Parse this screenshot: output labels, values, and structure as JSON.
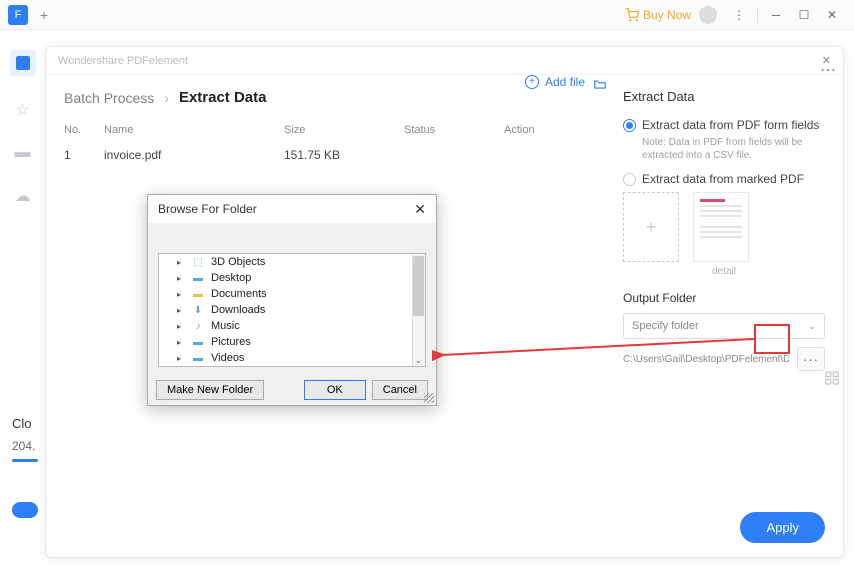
{
  "titlebar": {
    "buy_now": "Buy Now"
  },
  "modal": {
    "app_name": "Wondershare PDFelement",
    "breadcrumb_prev": "Batch Process",
    "breadcrumb_cur": "Extract Data",
    "add_file": "Add file",
    "headers": {
      "no": "No.",
      "name": "Name",
      "size": "Size",
      "status": "Status",
      "action": "Action"
    },
    "rows": [
      {
        "no": "1",
        "name": "invoice.pdf",
        "size": "151.75 KB",
        "status": "",
        "action": ""
      }
    ]
  },
  "right": {
    "title": "Extract Data",
    "opt_form": "Extract data from PDF form fields",
    "opt_form_note": "Note: Data in PDF from fields will be extracted into a CSV file.",
    "opt_marked": "Extract data from marked PDF",
    "detail": "detail",
    "output_folder": "Output Folder",
    "specify": "Specify folder",
    "path": "C:\\Users\\Gail\\Desktop\\PDFelement\\Da",
    "apply": "Apply"
  },
  "bfdialog": {
    "title": "Browse For Folder",
    "items": [
      "3D Objects",
      "Desktop",
      "Documents",
      "Downloads",
      "Music",
      "Pictures",
      "Videos"
    ],
    "new_folder": "Make New Folder",
    "ok": "OK",
    "cancel": "Cancel"
  },
  "leftpanel": {
    "clo": "Clo",
    "size": "204."
  }
}
